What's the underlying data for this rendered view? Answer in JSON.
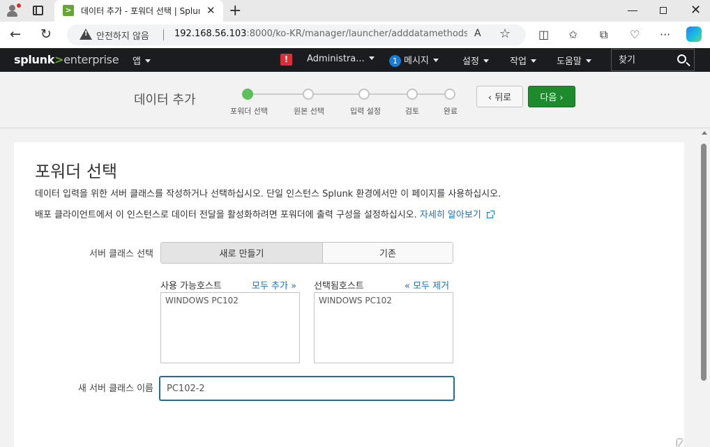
{
  "browser": {
    "tab_title": "데이터 추가 - 포워더 선택 | Splunk",
    "favicon_glyph": ">",
    "close_glyph": "✕",
    "newtab_glyph": "+",
    "security_label": "안전하지 않음",
    "url_host": "192.168.56.103",
    "url_rest": ":8000/ko-KR/manager/launcher/adddatamethods/...",
    "read_aloud_glyph": "A",
    "star_glyph": "☆",
    "back_glyph": "←",
    "reload_glyph": "↻",
    "split_glyph": "◫",
    "favorites_glyph": "✩",
    "collections_glyph": "⧉",
    "health_glyph": "♡",
    "more_glyph": "···",
    "win_close_glyph": "✕"
  },
  "splunk_nav": {
    "logo_splunk": "splunk",
    "logo_gt": ">",
    "logo_enterprise": "enterprise",
    "apps": "앱",
    "alert_glyph": "!",
    "user": "Administra...",
    "messages_count": "1",
    "messages": "메시지",
    "settings": "설정",
    "activity": "작업",
    "help": "도움말",
    "search_placeholder": "찾기"
  },
  "wizard": {
    "title": "데이터 추가",
    "steps": [
      {
        "label": "포워더 선택",
        "active": true
      },
      {
        "label": "원본 선택",
        "active": false
      },
      {
        "label": "입력 설정",
        "active": false
      },
      {
        "label": "검토",
        "active": false
      },
      {
        "label": "완료",
        "active": false
      }
    ],
    "back_label": "‹ 뒤로",
    "next_label": "다음 ›"
  },
  "content": {
    "page_title": "포워더 선택",
    "description_1": "데이터 입력을 위한 서버 클래스를 작성하거나 선택하십시오. 단일 인스턴스 Splunk 환경에서만 이 페이지를 사용하십시오.",
    "description_2": "배포 클라이언트에서 이 인스턴스로 데이터 전달을 활성화하려면 포워더에 출력 구성을 설정하십시오.",
    "learn_more": "자세히 알아보기",
    "server_class_label": "서버 클래스 선택",
    "server_class_options": [
      "새로 만들기",
      "기존"
    ],
    "server_class_selected": "새로 만들기",
    "available_hosts_label": "사용 가능호스트",
    "add_all": "모두 추가 »",
    "available_hosts": [
      "WINDOWS  PC102"
    ],
    "selected_hosts_label": "선택됨호스트",
    "remove_all": "« 모두 제거",
    "selected_hosts": [
      "WINDOWS  PC102"
    ],
    "new_class_name_label": "새 서버 클래스 이름",
    "new_class_name_value": "PC102-2"
  },
  "colors": {
    "splunk_green": "#65a637",
    "next_button": "#1e8a2e",
    "active_step": "#5cc05c",
    "link": "#1a6fb5",
    "input_focus": "#1f6e99",
    "nav_bg": "#1a1c20"
  }
}
